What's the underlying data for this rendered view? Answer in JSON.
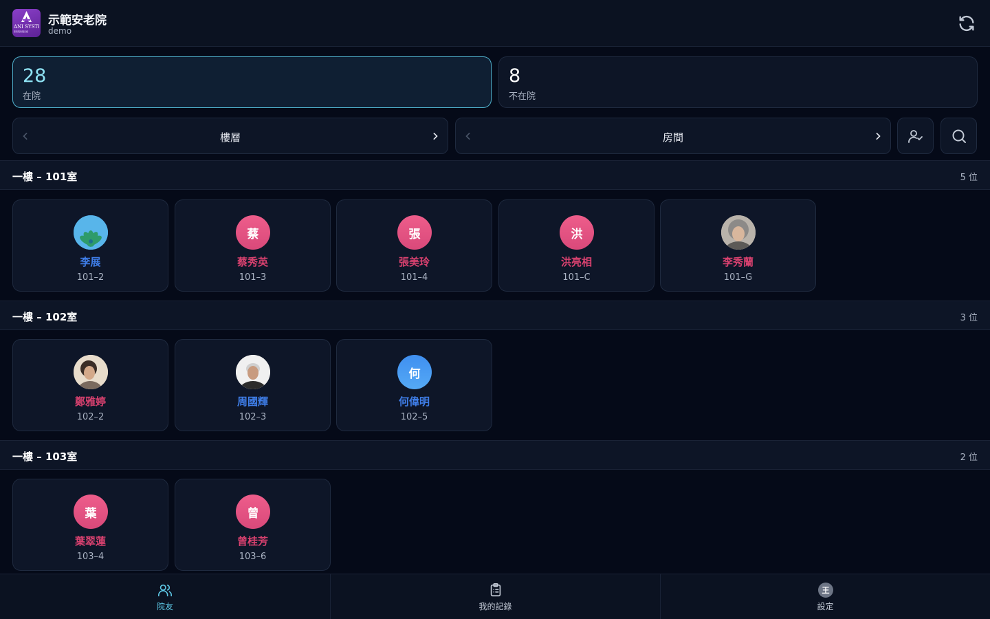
{
  "header": {
    "org_name": "示範安老院",
    "org_sub": "demo",
    "logo_text": "ANI SYSTEMS",
    "logo_subtext": "安老院管理系統",
    "refresh_icon": "refresh-icon"
  },
  "stats": [
    {
      "value": "28",
      "label": "在院",
      "active": true
    },
    {
      "value": "8",
      "label": "不在院",
      "active": false
    }
  ],
  "filters": {
    "floor_label": "樓層",
    "room_label": "房間",
    "attendance_icon": "user-check-icon",
    "search_icon": "search-icon"
  },
  "sections": [
    {
      "title": "一樓 – 101室",
      "count": "5 位",
      "residents": [
        {
          "initial": "",
          "name": "李展",
          "bed": "101–2",
          "gender": "male",
          "avatar": "peacock"
        },
        {
          "initial": "蔡",
          "name": "蔡秀英",
          "bed": "101–3",
          "gender": "female",
          "avatar": "pink"
        },
        {
          "initial": "張",
          "name": "張美玲",
          "bed": "101–4",
          "gender": "female",
          "avatar": "pink"
        },
        {
          "initial": "洪",
          "name": "洪亮相",
          "bed": "101–C",
          "gender": "female",
          "avatar": "pink"
        },
        {
          "initial": "",
          "name": "李秀蘭",
          "bed": "101–G",
          "gender": "female",
          "avatar": "photo-grey"
        }
      ]
    },
    {
      "title": "一樓 – 102室",
      "count": "3 位",
      "residents": [
        {
          "initial": "",
          "name": "鄭雅婷",
          "bed": "102–2",
          "gender": "female",
          "avatar": "photo-dark"
        },
        {
          "initial": "",
          "name": "周國輝",
          "bed": "102–3",
          "gender": "male",
          "avatar": "photo-white"
        },
        {
          "initial": "何",
          "name": "何偉明",
          "bed": "102–5",
          "gender": "male",
          "avatar": "blue"
        }
      ]
    },
    {
      "title": "一樓 – 103室",
      "count": "2 位",
      "residents": [
        {
          "initial": "葉",
          "name": "葉翠蓮",
          "bed": "103–4",
          "gender": "female",
          "avatar": "pink"
        },
        {
          "initial": "曾",
          "name": "曾桂芳",
          "bed": "103–6",
          "gender": "female",
          "avatar": "pink"
        }
      ]
    }
  ],
  "bottom_nav": [
    {
      "label": "院友",
      "icon": "users-icon",
      "active": true
    },
    {
      "label": "我的記錄",
      "icon": "clipboard-icon",
      "active": false
    },
    {
      "label": "設定",
      "icon": "avatar-icon",
      "initial": "王",
      "active": false
    }
  ],
  "colors": {
    "background": "#050a18",
    "accent": "#5ec8e6",
    "female": "#d8416f",
    "male": "#3f7ee8"
  }
}
